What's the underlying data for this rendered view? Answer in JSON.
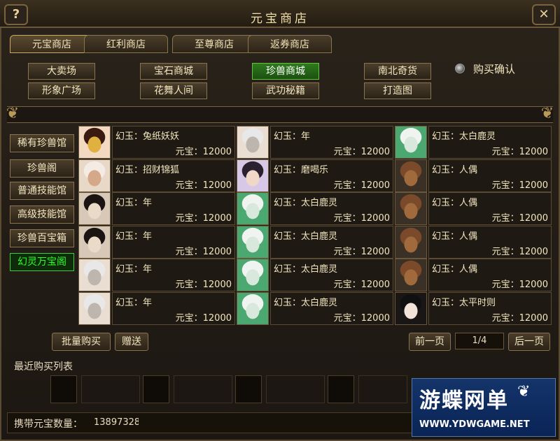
{
  "window": {
    "title": "元宝商店",
    "help_glyph": "?",
    "close_glyph": "✕"
  },
  "tabs": [
    {
      "label": "元宝商店",
      "active": true
    },
    {
      "label": "红利商店",
      "active": false
    },
    {
      "label": "至尊商店",
      "active": false
    },
    {
      "label": "返券商店",
      "active": false
    }
  ],
  "categories": [
    {
      "label": "大卖场",
      "active": false
    },
    {
      "label": "宝石商城",
      "active": false
    },
    {
      "label": "珍兽商城",
      "active": true
    },
    {
      "label": "南北奇货",
      "active": false
    },
    {
      "label": "形象广场",
      "active": false
    },
    {
      "label": "花舞人间",
      "active": false
    },
    {
      "label": "武功秘籍",
      "active": false
    },
    {
      "label": "打造图",
      "active": false
    }
  ],
  "purchase_confirm": {
    "label": "购买确认",
    "checked": false
  },
  "sidebar": [
    {
      "label": "稀有珍兽馆",
      "active": false
    },
    {
      "label": "珍兽阁",
      "active": false
    },
    {
      "label": "普通技能馆",
      "active": false
    },
    {
      "label": "高级技能馆",
      "active": false
    },
    {
      "label": "珍兽百宝箱",
      "active": false
    },
    {
      "label": "幻灵万宝阁",
      "active": true
    }
  ],
  "items": [
    {
      "name": "幻玉：兔纸妖妖",
      "price": "元宝：12000",
      "portrait": "girl-with-crown"
    },
    {
      "name": "幻玉：年",
      "price": "元宝：12000",
      "portrait": "white-hair"
    },
    {
      "name": "幻玉：太白鹿灵",
      "price": "元宝：12000",
      "portrait": "white-deer"
    },
    {
      "name": "幻玉：招财锦狐",
      "price": "元宝：12000",
      "portrait": "fox"
    },
    {
      "name": "幻玉：磨喝乐",
      "price": "元宝：12000",
      "portrait": "twin-dolls"
    },
    {
      "name": "幻玉：人偶",
      "price": "元宝：12000",
      "portrait": "cowboy-hat"
    },
    {
      "name": "幻玉：年",
      "price": "元宝：12000",
      "portrait": "dark-hair"
    },
    {
      "name": "幻玉：太白鹿灵",
      "price": "元宝：12000",
      "portrait": "white-deer"
    },
    {
      "name": "幻玉：人偶",
      "price": "元宝：12000",
      "portrait": "cowboy-hat"
    },
    {
      "name": "幻玉：年",
      "price": "元宝：12000",
      "portrait": "dark-hair"
    },
    {
      "name": "幻玉：太白鹿灵",
      "price": "元宝：12000",
      "portrait": "white-deer"
    },
    {
      "name": "幻玉：人偶",
      "price": "元宝：12000",
      "portrait": "cowboy-hat"
    },
    {
      "name": "幻玉：年",
      "price": "元宝：12000",
      "portrait": "white-hair"
    },
    {
      "name": "幻玉：太白鹿灵",
      "price": "元宝：12000",
      "portrait": "white-deer"
    },
    {
      "name": "幻玉：人偶",
      "price": "元宝：12000",
      "portrait": "cowboy-hat"
    },
    {
      "name": "幻玉：年",
      "price": "元宝：12000",
      "portrait": "white-hair"
    },
    {
      "name": "幻玉：太白鹿灵",
      "price": "元宝：12000",
      "portrait": "white-deer"
    },
    {
      "name": "幻玉：太平时则",
      "price": "元宝：12000",
      "portrait": "dark-hair-girl"
    }
  ],
  "buttons": {
    "batch_buy": "批量购买",
    "gift": "赠送",
    "prev_page": "前一页",
    "next_page": "后一页"
  },
  "pagination": {
    "current": 1,
    "total": 4,
    "text": "1/4"
  },
  "recent": {
    "label": "最近购买列表"
  },
  "balance": {
    "label": "携带元宝数量：",
    "value": "13897328"
  },
  "watermark": {
    "main": "游蝶网单",
    "sub": "WWW.YDWGAME.NET"
  },
  "colors": {
    "active_category": "#2f7a1e",
    "active_sidebar_text": "#2cff2c",
    "frame": "#5a4a32",
    "watermark_bg": "#0a2456"
  }
}
